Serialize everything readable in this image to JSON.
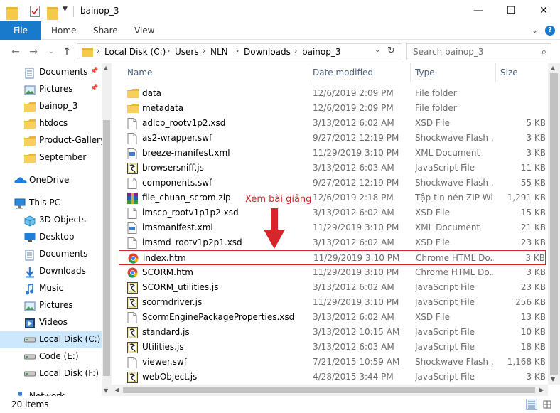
{
  "window": {
    "title": "bainop_3",
    "minimize_glyph": "—",
    "maximize_glyph": "☐",
    "close_glyph": "✕"
  },
  "ribbon": {
    "file_tab": "File",
    "tabs": [
      "Home",
      "Share",
      "View"
    ]
  },
  "address": {
    "crumbs": [
      "Local Disk (C:)",
      "Users",
      "NLN",
      "Downloads",
      "bainop_3"
    ]
  },
  "search": {
    "placeholder": "Search bainop_3"
  },
  "nav_pane": {
    "items": [
      {
        "label": "Documents",
        "icon": "documents-icon",
        "pinned": true,
        "level": 1
      },
      {
        "label": "Pictures",
        "icon": "pictures-icon",
        "pinned": true,
        "level": 1
      },
      {
        "label": "bainop_3",
        "icon": "folder-icon",
        "pinned": false,
        "level": 1
      },
      {
        "label": "htdocs",
        "icon": "folder-icon",
        "pinned": false,
        "level": 1
      },
      {
        "label": "Product-Gallery-",
        "icon": "folder-icon",
        "pinned": false,
        "level": 1
      },
      {
        "label": "September",
        "icon": "folder-icon",
        "pinned": false,
        "level": 1
      },
      {
        "label": "OneDrive",
        "icon": "onedrive-icon",
        "pinned": false,
        "level": 0
      },
      {
        "label": "This PC",
        "icon": "pc-icon",
        "pinned": false,
        "level": 0
      },
      {
        "label": "3D Objects",
        "icon": "3d-objects-icon",
        "pinned": false,
        "level": 1
      },
      {
        "label": "Desktop",
        "icon": "desktop-icon",
        "pinned": false,
        "level": 1
      },
      {
        "label": "Documents",
        "icon": "documents-icon",
        "pinned": false,
        "level": 1
      },
      {
        "label": "Downloads",
        "icon": "downloads-icon",
        "pinned": false,
        "level": 1
      },
      {
        "label": "Music",
        "icon": "music-icon",
        "pinned": false,
        "level": 1
      },
      {
        "label": "Pictures",
        "icon": "pictures-icon",
        "pinned": false,
        "level": 1
      },
      {
        "label": "Videos",
        "icon": "videos-icon",
        "pinned": false,
        "level": 1
      },
      {
        "label": "Local Disk (C:)",
        "icon": "drive-icon",
        "pinned": false,
        "level": 1,
        "selected": true
      },
      {
        "label": "Code (E:)",
        "icon": "drive-icon",
        "pinned": false,
        "level": 1
      },
      {
        "label": "Local Disk (F:)",
        "icon": "drive-icon",
        "pinned": false,
        "level": 1
      },
      {
        "label": "Network",
        "icon": "network-icon",
        "pinned": false,
        "level": 0
      }
    ]
  },
  "columns": {
    "name": "Name",
    "date": "Date modified",
    "type": "Type",
    "size": "Size"
  },
  "files": [
    {
      "name": "data",
      "date": "12/6/2019 2:09 PM",
      "type": "File folder",
      "size": "",
      "icon": "folder-icon"
    },
    {
      "name": "metadata",
      "date": "12/6/2019 2:09 PM",
      "type": "File folder",
      "size": "",
      "icon": "folder-icon"
    },
    {
      "name": "adlcp_rootv1p2.xsd",
      "date": "3/13/2012 6:02 AM",
      "type": "XSD File",
      "size": "5 KB",
      "icon": "file-icon"
    },
    {
      "name": "as2-wrapper.swf",
      "date": "9/27/2012 12:19 PM",
      "type": "Shockwave Flash ...",
      "size": "3 KB",
      "icon": "file-icon"
    },
    {
      "name": "breeze-manifest.xml",
      "date": "11/29/2019 3:10 PM",
      "type": "XML Document",
      "size": "3 KB",
      "icon": "xml-icon"
    },
    {
      "name": "browsersniff.js",
      "date": "3/13/2012 6:03 AM",
      "type": "JavaScript File",
      "size": "11 KB",
      "icon": "js-icon"
    },
    {
      "name": "components.swf",
      "date": "9/27/2012 12:19 PM",
      "type": "Shockwave Flash ...",
      "size": "55 KB",
      "icon": "file-icon"
    },
    {
      "name": "file_chuan_scrom.zip",
      "date": "12/6/2019 2:18 PM",
      "type": "Tập tin nén ZIP Wi...",
      "size": "1,291 KB",
      "icon": "zip-icon"
    },
    {
      "name": "imscp_rootv1p1p2.xsd",
      "date": "3/13/2012 6:02 AM",
      "type": "XSD File",
      "size": "15 KB",
      "icon": "file-icon"
    },
    {
      "name": "imsmanifest.xml",
      "date": "11/29/2019 3:10 PM",
      "type": "XML Document",
      "size": "21 KB",
      "icon": "xml-icon"
    },
    {
      "name": "imsmd_rootv1p2p1.xsd",
      "date": "3/13/2012 6:02 AM",
      "type": "XSD File",
      "size": "23 KB",
      "icon": "file-icon"
    },
    {
      "name": "index.htm",
      "date": "11/29/2019 3:10 PM",
      "type": "Chrome HTML Do...",
      "size": "3 KB",
      "icon": "chrome-icon",
      "highlighted": true
    },
    {
      "name": "SCORM.htm",
      "date": "11/29/2019 3:10 PM",
      "type": "Chrome HTML Do...",
      "size": "3 KB",
      "icon": "chrome-icon"
    },
    {
      "name": "SCORM_utilities.js",
      "date": "3/13/2012 6:02 AM",
      "type": "JavaScript File",
      "size": "23 KB",
      "icon": "js-icon"
    },
    {
      "name": "scormdriver.js",
      "date": "11/29/2019 3:10 PM",
      "type": "JavaScript File",
      "size": "256 KB",
      "icon": "js-icon"
    },
    {
      "name": "ScormEnginePackageProperties.xsd",
      "date": "3/13/2012 6:02 AM",
      "type": "XSD File",
      "size": "13 KB",
      "icon": "file-icon"
    },
    {
      "name": "standard.js",
      "date": "3/13/2012 10:15 AM",
      "type": "JavaScript File",
      "size": "10 KB",
      "icon": "js-icon"
    },
    {
      "name": "Utilities.js",
      "date": "3/13/2012 6:03 AM",
      "type": "JavaScript File",
      "size": "18 KB",
      "icon": "js-icon"
    },
    {
      "name": "viewer.swf",
      "date": "7/21/2015 10:59 AM",
      "type": "Shockwave Flash ...",
      "size": "1,168 KB",
      "icon": "file-icon"
    },
    {
      "name": "webObject.js",
      "date": "4/28/2015 3:44 PM",
      "type": "JavaScript File",
      "size": "3 KB",
      "icon": "js-icon"
    }
  ],
  "annotation": {
    "text": "Xem bài giảng",
    "color": "#d6262b"
  },
  "status": {
    "item_count": "20 items"
  },
  "colors": {
    "accent": "#1979ca",
    "selection": "#cce8ff",
    "annotation": "#d6262b"
  }
}
